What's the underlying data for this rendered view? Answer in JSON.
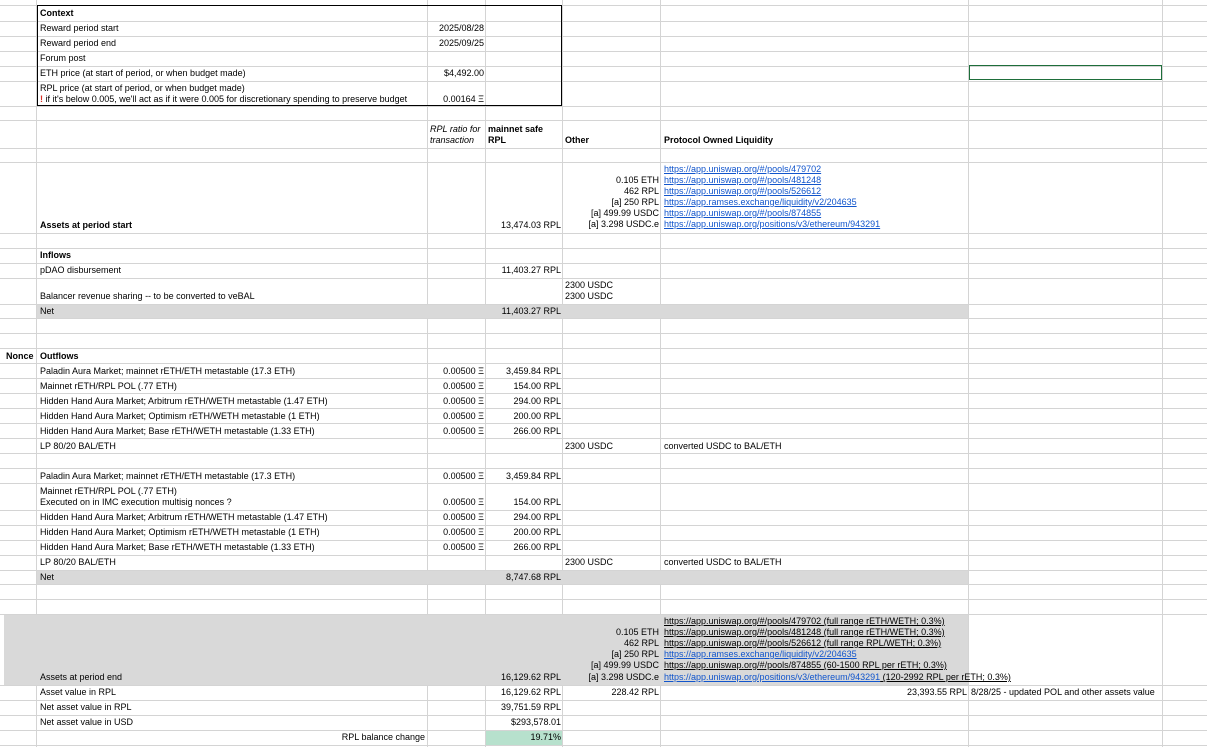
{
  "context": {
    "header": "Context",
    "reward_start_label": "Reward period start",
    "reward_start_value": "2025/08/28",
    "reward_end_label": "Reward period end",
    "reward_end_value": "2025/09/25",
    "forum_post_label": "Forum post",
    "eth_price_label": "ETH price (at start of period, or when budget made)",
    "eth_price_value": "$4,492.00",
    "rpl_price_label": "RPL price (at start of period, or when budget made)",
    "rpl_price_note_icon": "!",
    "rpl_price_note": "if it's below 0.005, we'll act as if it were 0.005 for discretionary spending to preserve budget",
    "rpl_price_value": "0.00164 Ξ"
  },
  "headers": {
    "rpl_ratio_line1": "RPL ratio for",
    "rpl_ratio_line2": "transaction",
    "mainnet_line1": "mainnet safe",
    "mainnet_line2": "RPL",
    "other": "Other",
    "pol": "Protocol Owned Liquidity"
  },
  "assets_start": {
    "label": "Assets at period start",
    "value": "13,474.03 RPL",
    "other": [
      "0.105 ETH",
      "462 RPL",
      "[a] 250 RPL",
      "[a] 499.99 USDC",
      "[a] 3.298 USDC.e"
    ],
    "links": [
      "https://app.uniswap.org/#/pools/479702",
      "https://app.uniswap.org/#/pools/481248",
      "https://app.uniswap.org/#/pools/526612",
      "https://app.ramses.exchange/liquidity/v2/204635",
      "https://app.uniswap.org/#/pools/874855",
      "https://app.uniswap.org/positions/v3/ethereum/943291"
    ]
  },
  "inflows": {
    "header": "Inflows",
    "pdao_label": "pDAO disbursement",
    "pdao_value": "11,403.27 RPL",
    "balancer_label": "Balancer revenue sharing -- to be converted to veBAL",
    "balancer_other_1": "2300 USDC",
    "balancer_other_2": "2300 USDC",
    "net_label": "Net",
    "net_value": "11,403.27 RPL"
  },
  "outflows": {
    "nonce_label": "Nonce",
    "header": "Outflows",
    "rows1": [
      {
        "label": "Paladin Aura Market; mainnet rETH/ETH metastable (17.3 ETH)",
        "ratio": "0.00500 Ξ",
        "value": "3,459.84 RPL"
      },
      {
        "label": "Mainnet rETH/RPL POL (.77 ETH)",
        "ratio": "0.00500 Ξ",
        "value": "154.00 RPL"
      },
      {
        "label": "Hidden Hand Aura Market; Arbitrum rETH/WETH metastable (1.47 ETH)",
        "ratio": "0.00500 Ξ",
        "value": "294.00 RPL"
      },
      {
        "label": "Hidden Hand Aura Market; Optimism rETH/WETH metastable (1 ETH)",
        "ratio": "0.00500 Ξ",
        "value": "200.00 RPL"
      },
      {
        "label": "Hidden Hand Aura Market; Base rETH/WETH metastable (1.33 ETH)",
        "ratio": "0.00500 Ξ",
        "value": "266.00 RPL"
      }
    ],
    "lp1": {
      "label": "LP 80/20 BAL/ETH",
      "other": "2300 USDC",
      "note": "converted USDC to BAL/ETH"
    },
    "rows2_first": {
      "label": "Paladin Aura Market; mainnet rETH/ETH metastable (17.3 ETH)",
      "ratio": "0.00500 Ξ",
      "value": "3,459.84 RPL"
    },
    "rows2_mainnet_line1": "Mainnet rETH/RPL POL (.77 ETH)",
    "rows2_mainnet_line2": "Executed on in IMC execution multisig nonces ?",
    "rows2_mainnet_ratio": "0.00500 Ξ",
    "rows2_mainnet_value": "154.00 RPL",
    "rows2": [
      {
        "label": "Hidden Hand Aura Market; Arbitrum rETH/WETH metastable (1.47 ETH)",
        "ratio": "0.00500 Ξ",
        "value": "294.00 RPL"
      },
      {
        "label": "Hidden Hand Aura Market; Optimism rETH/WETH metastable (1 ETH)",
        "ratio": "0.00500 Ξ",
        "value": "200.00 RPL"
      },
      {
        "label": "Hidden Hand Aura Market; Base rETH/WETH metastable (1.33 ETH)",
        "ratio": "0.00500 Ξ",
        "value": "266.00 RPL"
      }
    ],
    "lp2": {
      "label": "LP 80/20 BAL/ETH",
      "other": "2300 USDC",
      "note": "converted USDC to BAL/ETH"
    },
    "net_label": "Net",
    "net_value": "8,747.68 RPL"
  },
  "assets_end": {
    "label": "Assets at period end",
    "value": "16,129.62 RPL",
    "other": [
      "0.105 ETH",
      "462 RPL",
      "[a] 250 RPL",
      "[a] 499.99 USDC",
      "[a] 3.298 USDC.e"
    ],
    "links": [
      "https://app.uniswap.org/#/pools/479702 (full range rETH/WETH; 0.3%)",
      "https://app.uniswap.org/#/pools/481248 (full range rETH/WETH; 0.3%)",
      "https://app.uniswap.org/#/pools/526612 (full range RPL/WETH; 0.3%)",
      "https://app.ramses.exchange/liquidity/v2/204635",
      "https://app.uniswap.org/#/pools/874855 (60-1500 RPL per rETH; 0.3%)"
    ],
    "last_link": "https://app.uniswap.org/positions/v3/ethereum/943291",
    "last_link_suffix": " (120-2992 RPL per rETH; 0.3%)"
  },
  "summary": {
    "asset_value_label": "Asset value in RPL",
    "asset_value": "16,129.62 RPL",
    "asset_value_other": "228.42 RPL",
    "asset_value_pol": "23,393.55 RPL",
    "asset_value_note": "8/28/25 - updated POL and other assets value",
    "net_rpl_label": "Net asset value in RPL",
    "net_rpl_value": "39,751.59 RPL",
    "net_usd_label": "Net asset value in USD",
    "net_usd_value": "$293,578.01",
    "change_label": "RPL balance change",
    "change_value": "19.71%"
  },
  "colors": {
    "grid": "#d4d4d4",
    "band": "#d9d9d9",
    "highlight": "#b7e1cd",
    "link": "#1155cc",
    "selection": "#1e6e3a"
  }
}
